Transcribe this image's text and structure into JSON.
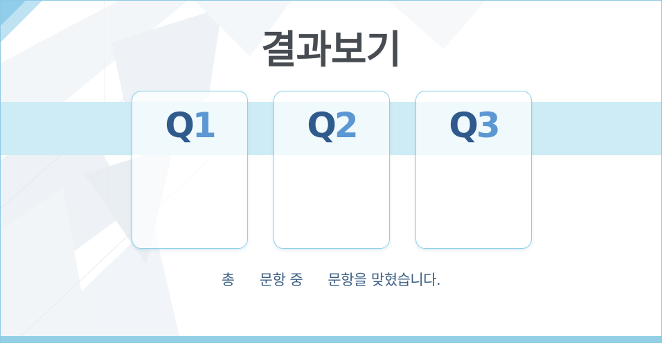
{
  "title": "결과보기",
  "questions": [
    {
      "letter": "Q",
      "number": "1"
    },
    {
      "letter": "Q",
      "number": "2"
    },
    {
      "letter": "Q",
      "number": "3"
    }
  ],
  "summary": {
    "part1": "총",
    "part2": "문항 중",
    "part3": "문항을 맞혔습니다."
  },
  "colors": {
    "border": "#8ec9e4",
    "band": "#ceecf5",
    "bottom_bar": "#93d0e6",
    "title": "#474c52",
    "q_letter": "#2f5a8c",
    "q_number": "#5b97d2",
    "summary_text": "#3c5f84"
  }
}
